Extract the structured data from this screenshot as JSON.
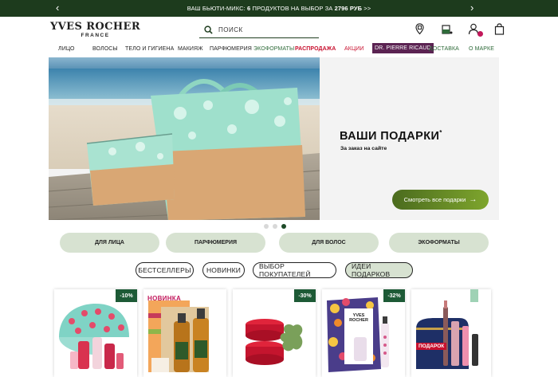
{
  "promo": {
    "text_prefix": "ВАШ БЬЮТИ-МИКС: ",
    "text_bold1": "6",
    "text_mid": " ПРОДУКТОВ НА ВЫБОР ЗА ",
    "text_bold2": "2796 РУБ",
    "text_suffix": " >>"
  },
  "logo": {
    "line1": "YVES ROCHER",
    "line2": "FRANCE"
  },
  "search": {
    "placeholder": "ПОИСК"
  },
  "header_icons": [
    "store-locator-icon",
    "cart-fill-icon",
    "account-icon",
    "bag-icon"
  ],
  "nav": {
    "items": [
      "ЛИЦО",
      "ВОЛОСЫ",
      "ТЕЛО И ГИГИЕНА",
      "МАКИЯЖ",
      "ПАРФЮМЕРИЯ",
      "ЭКОФОРМАТЫ",
      "РАСПРОДАЖА",
      "АКЦИИ",
      "DR. PIERRE RICAUD",
      "ДОСТАВКА",
      "О МАРКЕ"
    ]
  },
  "hero": {
    "title": "ВАШИ ПОДАРКИ",
    "title_mark": "*",
    "subtitle": "За заказ на сайте",
    "button": "Смотреть все подарки",
    "slides_total": 3,
    "slide_active": 3
  },
  "categories": [
    "ДЛЯ ЛИЦА",
    "ПАРФЮМЕРИЯ",
    "ДЛЯ ВОЛОС",
    "ЭКОФОРМАТЫ"
  ],
  "filters": {
    "items": [
      "БЕСТСЕЛЛЕРЫ",
      "НОВИНКИ",
      "ВЫБОР ПОКУПАТЕЛЕЙ",
      "ИДЕИ ПОДАРКОВ"
    ],
    "active": "ИДЕИ ПОДАРКОВ"
  },
  "products": [
    {
      "discount": "-10%"
    },
    {
      "label": "НОВИНКА"
    },
    {
      "discount": "-30%"
    },
    {
      "discount": "-32%",
      "brand_line1": "YVES",
      "brand_line2": "ROCHER"
    },
    {
      "tag": "ПОДАРОК"
    }
  ],
  "colors": {
    "promo_bg": "#1d3b1d",
    "accent_green": "#2f6b3a",
    "sale_red": "#c8102e",
    "pill_green": "#d7e2d1",
    "discount_bg": "#1d5a36",
    "dr_bg": "#5b2352"
  }
}
